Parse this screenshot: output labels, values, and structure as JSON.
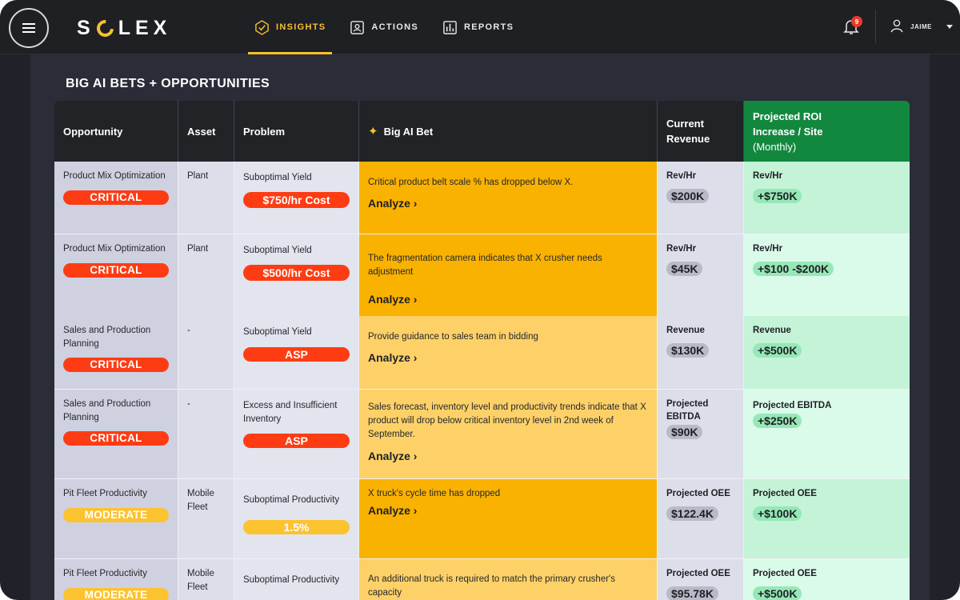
{
  "app": {
    "logo": "SOLEX",
    "logo_prefix": "S",
    "logo_suffix": "LEX"
  },
  "nav": [
    {
      "label": "INSIGHTS",
      "icon": "check-circle-icon",
      "active": true
    },
    {
      "label": "ACTIONS",
      "icon": "user-card-icon",
      "active": false
    },
    {
      "label": "REPORTS",
      "icon": "bar-chart-icon",
      "active": false
    }
  ],
  "notifications": {
    "count": "9"
  },
  "user": {
    "name": "JAIME"
  },
  "colors": {
    "accent": "#f5c12e",
    "critical": "#fe3c13",
    "moderate": "#fcc330",
    "roi_header": "#12883f"
  },
  "page": {
    "title": "BIG AI BETS + OPPORTUNITIES"
  },
  "table": {
    "headers": {
      "opportunity": "Opportunity",
      "asset": "Asset",
      "problem": "Problem",
      "bet": "Big AI Bet",
      "revenue_1": "Current",
      "revenue_2": "Revenue",
      "roi_1": "Projected ROI",
      "roi_2": "Increase / Site",
      "roi_3": "(Monthly)"
    },
    "analyze_label": "Analyze ›",
    "rows": [
      {
        "opportunity": "Product Mix Optimization",
        "severity": "CRITICAL",
        "asset": "Plant",
        "problem": "Suboptimal Yield",
        "cost": "$750/hr Cost",
        "bet": "Critical product belt scale % has dropped below X.",
        "rev_label": "Rev/Hr",
        "rev_value": "$200K",
        "roi_label": "Rev/Hr",
        "roi_value": "+$750K"
      },
      {
        "opportunity": "Product Mix Optimization",
        "severity": "CRITICAL",
        "asset": "Plant",
        "problem": "Suboptimal Yield",
        "cost": "$500/hr Cost",
        "bet": "The fragmentation camera indicates that X crusher needs adjustment",
        "rev_label": "Rev/Hr",
        "rev_value": "$45K",
        "roi_label": "Rev/Hr",
        "roi_value": "+$100 -$200K"
      },
      {
        "opportunity": "Sales and Production Planning",
        "severity": "CRITICAL",
        "asset": "-",
        "problem": "Suboptimal Yield",
        "cost": "ASP",
        "bet": "Provide guidance to sales team in bidding",
        "rev_label": "Revenue",
        "rev_value": "$130K",
        "roi_label": "Revenue",
        "roi_value": "+$500K"
      },
      {
        "opportunity": "Sales and Production Planning",
        "severity": "CRITICAL",
        "asset": "-",
        "problem": "Excess and Insufficient Inventory",
        "cost": "ASP",
        "bet": "Sales forecast, inventory level and productivity trends indicate that X product will drop below critical inventory level in 2nd week of September.",
        "rev_label": "Projected EBITDA",
        "rev_value": "$90K",
        "roi_label": "Projected EBITDA",
        "roi_value": "+$250K"
      },
      {
        "opportunity": "Pit Fleet Productivity",
        "severity": "MODERATE",
        "asset": "Mobile Fleet",
        "problem": "Suboptimal Productivity",
        "cost": "1.5%",
        "bet": "X truck's cycle time has dropped",
        "rev_label": "Projected OEE",
        "rev_value": "$122.4K",
        "roi_label": "Projected OEE",
        "roi_value": "+$100K"
      },
      {
        "opportunity": "Pit Fleet Productivity",
        "severity": "MODERATE",
        "asset": "Mobile Fleet",
        "problem": "Suboptimal Productivity",
        "cost": "",
        "bet": "An additional truck is required to match the primary crusher's capacity",
        "rev_label": "Projected OEE",
        "rev_value": "$95.78K",
        "roi_label": "Projected OEE",
        "roi_value": "+$500K"
      }
    ]
  }
}
